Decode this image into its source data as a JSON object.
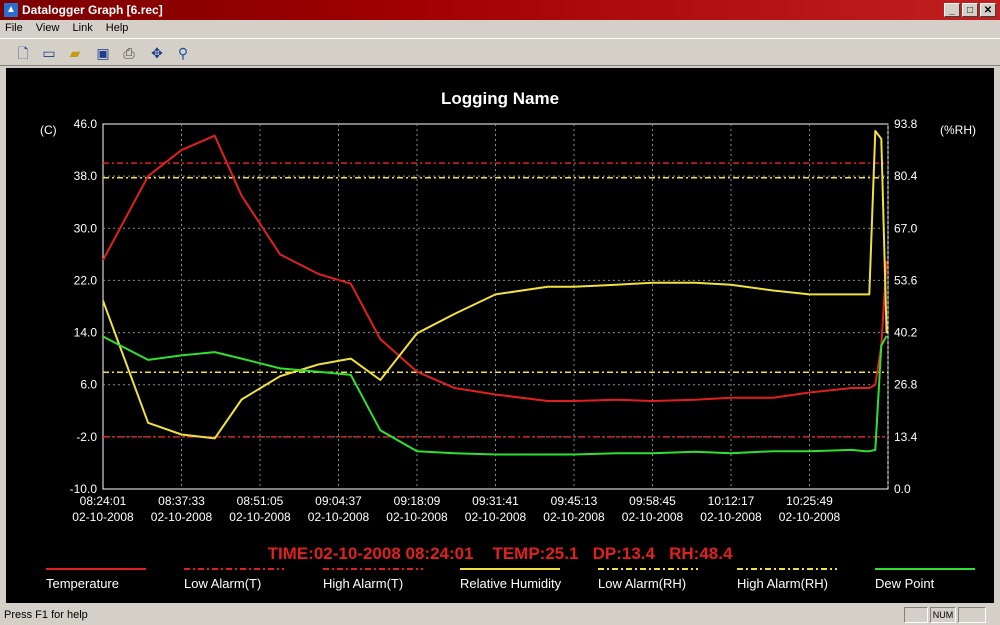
{
  "window": {
    "title": "Datalogger Graph [6.rec]",
    "controls": [
      "_",
      "□",
      "✕"
    ]
  },
  "menu": [
    "File",
    "View",
    "Link",
    "Help"
  ],
  "toolbar": [
    {
      "name": "new-icon",
      "glyph": "🗋"
    },
    {
      "name": "device-icon",
      "glyph": "▭"
    },
    {
      "name": "open-folder-icon",
      "glyph": "▰"
    },
    {
      "name": "save-icon",
      "glyph": "▣"
    },
    {
      "name": "print-icon",
      "glyph": "⎙"
    },
    {
      "name": "fit-icon",
      "glyph": "✥"
    },
    {
      "name": "zoom-icon",
      "glyph": "⚲"
    }
  ],
  "status": {
    "help": "Press F1 for help",
    "num": "NUM"
  },
  "chart_data": {
    "type": "line",
    "title": "Logging Name",
    "ylabel_left": "(C)",
    "ylabel_right": "(%RH)",
    "ylim_left": [
      -10,
      46
    ],
    "ylim_right": [
      0,
      93.8
    ],
    "yticks_left": [
      "46.0",
      "38.0",
      "30.0",
      "22.0",
      "14.0",
      "6.0",
      "-2.0",
      "-10.0"
    ],
    "yticks_right": [
      "93.8",
      "80.4",
      "67.0",
      "53.6",
      "40.2",
      "26.8",
      "13.4",
      "0.0"
    ],
    "xticks": [
      {
        "time": "08:24:01",
        "date": "02-10-2008"
      },
      {
        "time": "08:37:33",
        "date": "02-10-2008"
      },
      {
        "time": "08:51:05",
        "date": "02-10-2008"
      },
      {
        "time": "09:04:37",
        "date": "02-10-2008"
      },
      {
        "time": "09:18:09",
        "date": "02-10-2008"
      },
      {
        "time": "09:31:41",
        "date": "02-10-2008"
      },
      {
        "time": "09:45:13",
        "date": "02-10-2008"
      },
      {
        "time": "09:58:45",
        "date": "02-10-2008"
      },
      {
        "time": "10:12:17",
        "date": "02-10-2008"
      },
      {
        "time": "10:25:49",
        "date": "02-10-2008"
      }
    ],
    "x": [
      "08:24:01",
      "08:31:47",
      "08:37:33",
      "08:43:16",
      "08:47:55",
      "08:54:33",
      "09:01:08",
      "09:06:44",
      "09:11:49",
      "09:18:09",
      "09:24:38",
      "09:31:41",
      "09:40:40",
      "09:45:13",
      "09:52:31",
      "09:58:45",
      "10:06:06",
      "10:12:17",
      "10:19:34",
      "10:25:49",
      "10:33:08",
      "10:35:27",
      "10:36:08",
      "10:37:10",
      "10:38:12",
      "10:39:07"
    ],
    "series": [
      {
        "name": "Temperature",
        "axis": "left",
        "color": "#e02020",
        "values": [
          25.1,
          38,
          42,
          44.2,
          35,
          26,
          23,
          21.5,
          13,
          8,
          5.5,
          4.5,
          3.5,
          3.5,
          3.7,
          3.5,
          3.7,
          4,
          4,
          4.8,
          5.5,
          5.5,
          5.5,
          6,
          12,
          25
        ]
      },
      {
        "name": "Relative Humidity",
        "axis": "right",
        "color": "#f0e040",
        "values": [
          48.4,
          17,
          14,
          13,
          23,
          29,
          32,
          33.5,
          28,
          40,
          45,
          50,
          52,
          52,
          52.5,
          53,
          53,
          52.5,
          51,
          50,
          50,
          50,
          50,
          92,
          90,
          40
        ]
      },
      {
        "name": "Dew Point",
        "axis": "left",
        "color": "#30e030",
        "values": [
          13.4,
          9.8,
          10.5,
          11,
          10,
          8.5,
          8,
          7.5,
          -1,
          -4.2,
          -4.5,
          -4.7,
          -4.7,
          -4.7,
          -4.5,
          -4.5,
          -4.3,
          -4.5,
          -4.2,
          -4.2,
          -4,
          -4.2,
          -4.2,
          -4,
          12,
          13.5
        ]
      }
    ],
    "alarms": [
      {
        "name": "Low Alarm(T)",
        "axis": "left",
        "value": -2,
        "color": "#e02020"
      },
      {
        "name": "High Alarm(T)",
        "axis": "left",
        "value": 40,
        "color": "#e02020"
      },
      {
        "name": "Low Alarm(RH)",
        "axis": "right",
        "value": 30,
        "color": "#f0e040"
      },
      {
        "name": "High Alarm(RH)",
        "axis": "right",
        "value": 80,
        "color": "#f0e040"
      }
    ],
    "legend": [
      "Temperature",
      "Low Alarm(T)",
      "High Alarm(T)",
      "Relative Humidity",
      "Low Alarm(RH)",
      "High Alarm(RH)",
      "Dew Point"
    ],
    "readout": "TIME:02-10-2008 08:24:01    TEMP:25.1   DP:13.4   RH:48.4",
    "grid": true
  }
}
